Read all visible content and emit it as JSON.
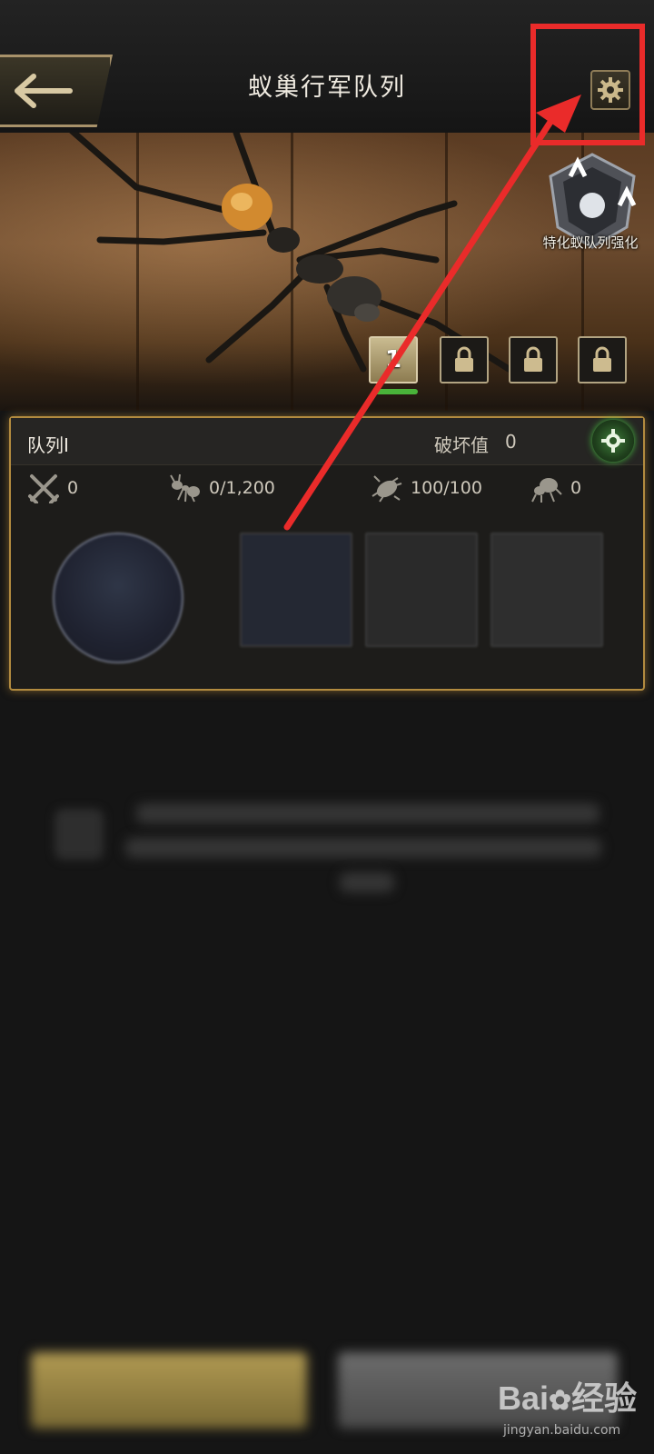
{
  "header": {
    "title": "蚁巢行军队列",
    "back_icon": "back-arrow-icon",
    "settings_icon": "gear-icon"
  },
  "hero": {
    "enhance_label": "特化蚁队列强化",
    "queue_tabs": [
      {
        "label": "1",
        "state": "active"
      },
      {
        "label": "",
        "state": "locked"
      },
      {
        "label": "",
        "state": "locked"
      },
      {
        "label": "",
        "state": "locked"
      }
    ]
  },
  "panel": {
    "queue_name": "队列Ⅰ",
    "destroy_label": "破坏值",
    "destroy_value": "0",
    "stats": [
      {
        "icon": "crossed-swords-icon",
        "value": "0"
      },
      {
        "icon": "worker-ant-icon",
        "value": "0/1,200"
      },
      {
        "icon": "beetle-icon",
        "value": "100/100"
      },
      {
        "icon": "special-ant-icon",
        "value": "0"
      }
    ]
  },
  "watermark": {
    "brand_left": "Bai",
    "brand_right": "经验",
    "url": "jingyan.baidu.com"
  },
  "colors": {
    "highlight_red": "#ea2b2a",
    "panel_border_gold": "#b28b3f",
    "active_green": "#49b33a"
  }
}
